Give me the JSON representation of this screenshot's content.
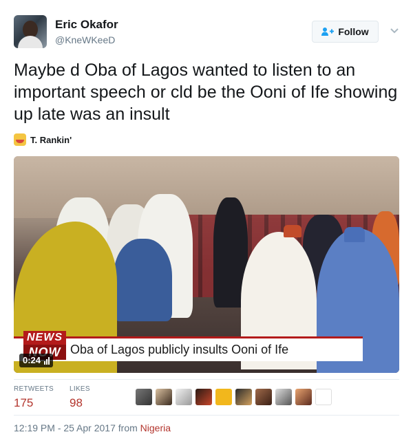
{
  "user": {
    "name": "Eric Okafor",
    "handle": "@KneWKeeD"
  },
  "follow_button": {
    "label": "Follow"
  },
  "tweet": {
    "text": "Maybe d Oba of Lagos wanted to listen to an important speech or cld be the Ooni of Ife showing up late was an insult",
    "attachment_label": "T. Rankin'"
  },
  "video": {
    "ticker_text": "Oba of Lagos publicly insults Ooni of Ife",
    "logo_line1": "NEWS",
    "logo_line2": "NOW",
    "duration": "0:24"
  },
  "stats": {
    "retweets_label": "RETWEETS",
    "retweets_count": "175",
    "likes_label": "LIKES",
    "likes_count": "98"
  },
  "footer": {
    "time": "12:19 PM - 25 Apr 2017 from",
    "place": "Nigeria"
  },
  "colors": {
    "accent": "#1da1f2",
    "count_red": "#b3352d",
    "muted": "#657786"
  }
}
